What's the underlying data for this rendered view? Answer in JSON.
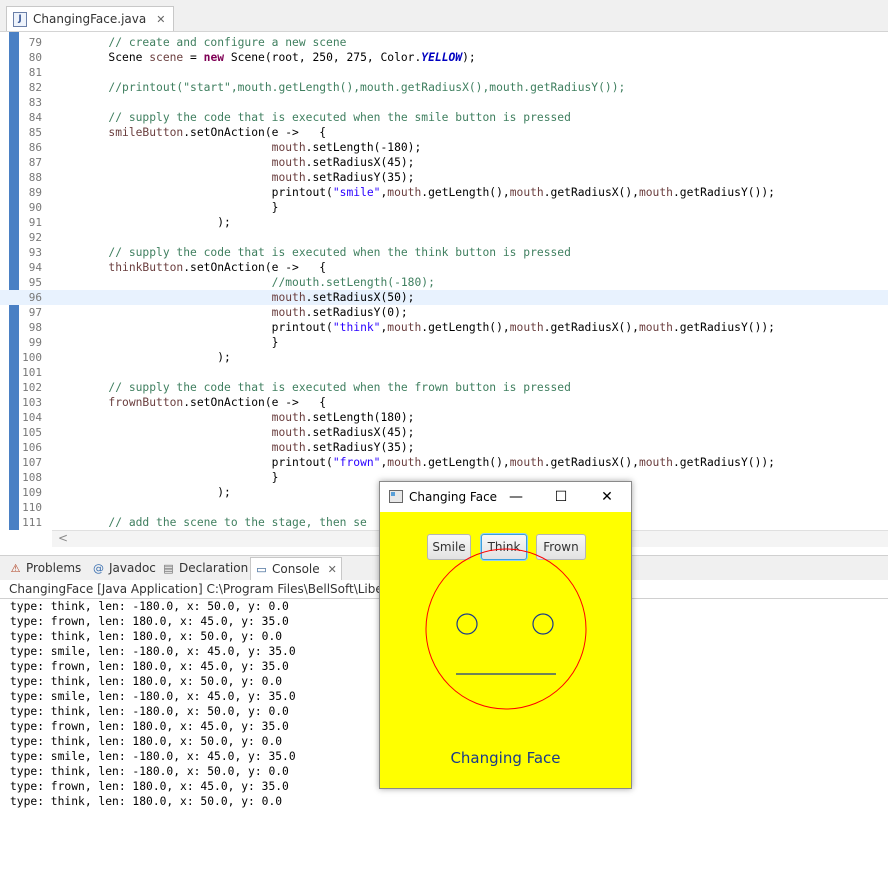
{
  "editor": {
    "tab_label": "ChangingFace.java",
    "lines": [
      {
        "num": "79",
        "tokens": [
          [
            "cm",
            "        // create and configure a new scene"
          ]
        ]
      },
      {
        "num": "80",
        "tokens": [
          [
            "",
            "        Scene "
          ],
          [
            "var",
            "scene"
          ],
          [
            "",
            " = "
          ],
          [
            "kw",
            "new"
          ],
          [
            "",
            " Scene(root, 250, 275, Color."
          ],
          [
            "fld",
            "YELLOW"
          ],
          [
            "",
            ");"
          ]
        ]
      },
      {
        "num": "81",
        "tokens": [
          [
            "",
            ""
          ]
        ]
      },
      {
        "num": "82",
        "tokens": [
          [
            "cm",
            "        //printout(\"start\",mouth.getLength(),mouth.getRadiusX(),mouth.getRadiusY());"
          ]
        ]
      },
      {
        "num": "83",
        "tokens": [
          [
            "",
            ""
          ]
        ]
      },
      {
        "num": "84",
        "tokens": [
          [
            "cm",
            "        // supply the code that is executed when the smile button is pressed"
          ]
        ]
      },
      {
        "num": "85",
        "tokens": [
          [
            "var",
            "        smileButton"
          ],
          [
            "",
            ".setOnAction(e ->   {"
          ]
        ]
      },
      {
        "num": "86",
        "tokens": [
          [
            "var",
            "                                mouth"
          ],
          [
            "",
            ".setLength(-180);"
          ]
        ]
      },
      {
        "num": "87",
        "tokens": [
          [
            "var",
            "                                mouth"
          ],
          [
            "",
            ".setRadiusX(45);"
          ]
        ]
      },
      {
        "num": "88",
        "tokens": [
          [
            "var",
            "                                mouth"
          ],
          [
            "",
            ".setRadiusY(35);"
          ]
        ]
      },
      {
        "num": "89",
        "tokens": [
          [
            "",
            "                                printout("
          ],
          [
            "st",
            "\"smile\""
          ],
          [
            "",
            ","
          ],
          [
            "var",
            "mouth"
          ],
          [
            "",
            ".getLength(),"
          ],
          [
            "var",
            "mouth"
          ],
          [
            "",
            ".getRadiusX(),"
          ],
          [
            "var",
            "mouth"
          ],
          [
            "",
            ".getRadiusY());"
          ]
        ]
      },
      {
        "num": "90",
        "tokens": [
          [
            "",
            "                                }"
          ]
        ]
      },
      {
        "num": "91",
        "tokens": [
          [
            "",
            "                        );"
          ]
        ]
      },
      {
        "num": "92",
        "tokens": [
          [
            "",
            ""
          ]
        ]
      },
      {
        "num": "93",
        "tokens": [
          [
            "cm",
            "        // supply the code that is executed when the think button is pressed"
          ]
        ]
      },
      {
        "num": "94",
        "tokens": [
          [
            "var",
            "        thinkButton"
          ],
          [
            "",
            ".setOnAction(e ->   {"
          ]
        ]
      },
      {
        "num": "95",
        "tokens": [
          [
            "cm",
            "                                //mouth.setLength(-180);"
          ]
        ]
      },
      {
        "num": "96",
        "tokens": [
          [
            "var",
            "                                mouth"
          ],
          [
            "",
            ".setRadiusX(50);"
          ]
        ],
        "highlight": true
      },
      {
        "num": "97",
        "tokens": [
          [
            "var",
            "                                mouth"
          ],
          [
            "",
            ".setRadiusY(0);"
          ]
        ]
      },
      {
        "num": "98",
        "tokens": [
          [
            "",
            "                                printout("
          ],
          [
            "st",
            "\"think\""
          ],
          [
            "",
            ","
          ],
          [
            "var",
            "mouth"
          ],
          [
            "",
            ".getLength(),"
          ],
          [
            "var",
            "mouth"
          ],
          [
            "",
            ".getRadiusX(),"
          ],
          [
            "var",
            "mouth"
          ],
          [
            "",
            ".getRadiusY());"
          ]
        ]
      },
      {
        "num": "99",
        "tokens": [
          [
            "",
            "                                }"
          ]
        ]
      },
      {
        "num": "100",
        "tokens": [
          [
            "",
            "                        );"
          ]
        ]
      },
      {
        "num": "101",
        "tokens": [
          [
            "",
            ""
          ]
        ]
      },
      {
        "num": "102",
        "tokens": [
          [
            "cm",
            "        // supply the code that is executed when the frown button is pressed"
          ]
        ]
      },
      {
        "num": "103",
        "tokens": [
          [
            "var",
            "        frownButton"
          ],
          [
            "",
            ".setOnAction(e ->   {"
          ]
        ]
      },
      {
        "num": "104",
        "tokens": [
          [
            "var",
            "                                mouth"
          ],
          [
            "",
            ".setLength(180);"
          ]
        ]
      },
      {
        "num": "105",
        "tokens": [
          [
            "var",
            "                                mouth"
          ],
          [
            "",
            ".setRadiusX(45);"
          ]
        ]
      },
      {
        "num": "106",
        "tokens": [
          [
            "var",
            "                                mouth"
          ],
          [
            "",
            ".setRadiusY(35);"
          ]
        ]
      },
      {
        "num": "107",
        "tokens": [
          [
            "",
            "                                printout("
          ],
          [
            "st",
            "\"frown\""
          ],
          [
            "",
            ","
          ],
          [
            "var",
            "mouth"
          ],
          [
            "",
            ".getLength(),"
          ],
          [
            "var",
            "mouth"
          ],
          [
            "",
            ".getRadiusX(),"
          ],
          [
            "var",
            "mouth"
          ],
          [
            "",
            ".getRadiusY());"
          ]
        ]
      },
      {
        "num": "108",
        "tokens": [
          [
            "",
            "                                }"
          ]
        ]
      },
      {
        "num": "109",
        "tokens": [
          [
            "",
            "                        );"
          ]
        ]
      },
      {
        "num": "110",
        "tokens": [
          [
            "",
            ""
          ]
        ]
      },
      {
        "num": "111",
        "tokens": [
          [
            "cm",
            "        // add the scene to the stage, then se"
          ]
        ]
      }
    ]
  },
  "views": {
    "tabs": [
      {
        "label": "Problems",
        "icon": "problems-icon",
        "glyph": "⚠"
      },
      {
        "label": "Javadoc",
        "icon": "javadoc-icon",
        "glyph": "@"
      },
      {
        "label": "Declaration",
        "icon": "declaration-icon",
        "glyph": "▤"
      },
      {
        "label": "Console",
        "icon": "console-icon",
        "glyph": "▭",
        "active": true
      }
    ],
    "console_header": "ChangingFace [Java Application] C:\\Program Files\\BellSoft\\LibericaJDK",
    "console_lines": [
      "type: think, len: -180.0, x: 50.0, y: 0.0",
      "type: frown, len: 180.0, x: 45.0, y: 35.0",
      "type: think, len: 180.0, x: 50.0, y: 0.0",
      "type: smile, len: -180.0, x: 45.0, y: 35.0",
      "type: frown, len: 180.0, x: 45.0, y: 35.0",
      "type: think, len: 180.0, x: 50.0, y: 0.0",
      "type: smile, len: -180.0, x: 45.0, y: 35.0",
      "type: think, len: -180.0, x: 50.0, y: 0.0",
      "type: frown, len: 180.0, x: 45.0, y: 35.0",
      "type: think, len: 180.0, x: 50.0, y: 0.0",
      "type: smile, len: -180.0, x: 45.0, y: 35.0",
      "type: think, len: -180.0, x: 50.0, y: 0.0",
      "type: frown, len: 180.0, x: 45.0, y: 35.0",
      "type: think, len: 180.0, x: 50.0, y: 0.0"
    ]
  },
  "fx_window": {
    "title": "Changing Face",
    "minimize": "—",
    "maximize": "☐",
    "close": "✕",
    "buttons": {
      "smile": "Smile",
      "think": "Think",
      "frown": "Frown"
    },
    "label": "Changing Face",
    "colors": {
      "background": "#ffff00",
      "outline": "#ff0000",
      "eyes": "#1a3a8a",
      "mouth": "#1a3a8a"
    }
  }
}
